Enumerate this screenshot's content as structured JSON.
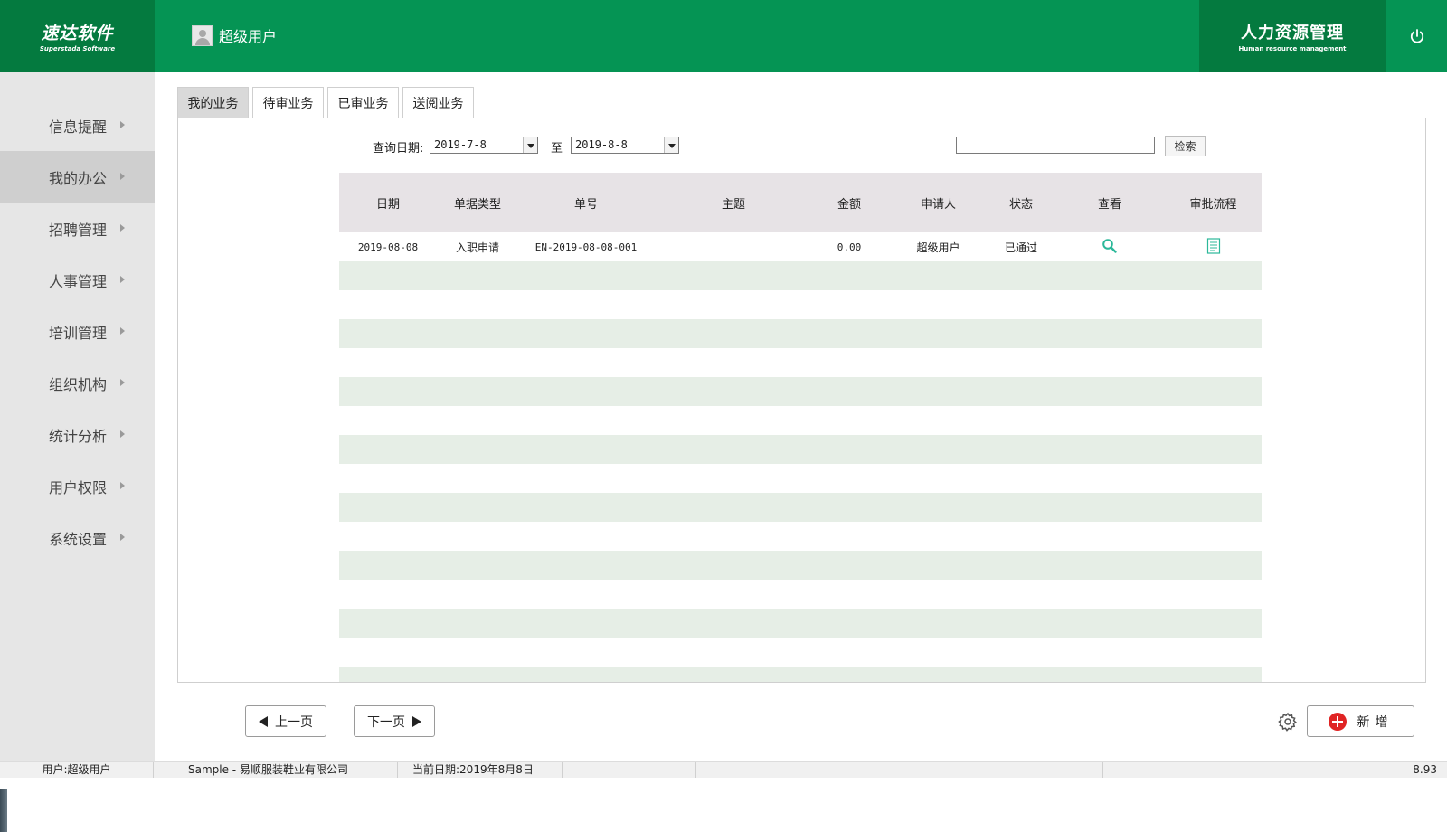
{
  "header": {
    "logo_main": "速达软件",
    "logo_sub": "Superstada Software",
    "username": "超级用户",
    "module_main": "人力资源管理",
    "module_sub": "Human resource management"
  },
  "sidebar": {
    "items": [
      {
        "label": "信息提醒"
      },
      {
        "label": "我的办公"
      },
      {
        "label": "招聘管理"
      },
      {
        "label": "人事管理"
      },
      {
        "label": "培训管理"
      },
      {
        "label": "组织机构"
      },
      {
        "label": "统计分析"
      },
      {
        "label": "用户权限"
      },
      {
        "label": "系统设置"
      }
    ]
  },
  "tabs": [
    "我的业务",
    "待审业务",
    "已审业务",
    "送阅业务"
  ],
  "query": {
    "date_label": "查询日期:",
    "date_from": "2019-7-8",
    "to_label": "至",
    "date_to": "2019-8-8",
    "search_value": "",
    "search_button": "检索"
  },
  "table": {
    "headers": [
      "日期",
      "单据类型",
      "单号",
      "主题",
      "金额",
      "申请人",
      "状态",
      "查看",
      "审批流程"
    ],
    "rows": [
      {
        "date": "2019-08-08",
        "type": "入职申请",
        "number": "EN-2019-08-08-001",
        "subject": "",
        "amount": "0.00",
        "applicant": "超级用户",
        "status": "已通过"
      }
    ]
  },
  "pager": {
    "prev": "上一页",
    "next": "下一页"
  },
  "actions": {
    "new": "新增"
  },
  "statusbar": {
    "user": "用户:超级用户",
    "company": "Sample - 易顺服装鞋业有限公司",
    "date": "当前日期:2019年8月8日",
    "version": "8.93"
  },
  "colors": {
    "brand_green": "#059454",
    "brand_dark_green": "#047a3f",
    "row_alt": "#e6eee6",
    "header_bg": "#e7e3e6",
    "view_icon": "#2cb89a",
    "add_red": "#e02424"
  },
  "icons": {
    "power": "power-icon",
    "view": "search-icon",
    "flow": "document-icon",
    "settings": "gear-icon",
    "add": "plus-circle-icon"
  }
}
